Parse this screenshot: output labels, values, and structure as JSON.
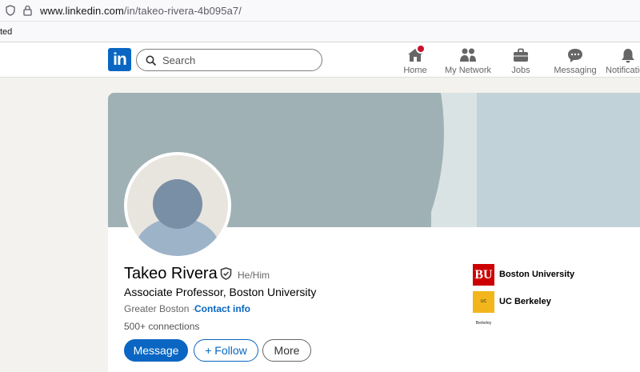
{
  "browser": {
    "url_host": "www.linkedin.com",
    "url_path": "/in/takeo-rivera-4b095a7/",
    "bookmark_partial": "ted"
  },
  "nav": {
    "logo": "in",
    "search_placeholder": "Search",
    "items": [
      {
        "label": "Home",
        "icon": "home-icon",
        "badge": true
      },
      {
        "label": "My Network",
        "icon": "network-icon"
      },
      {
        "label": "Jobs",
        "icon": "briefcase-icon"
      },
      {
        "label": "Messaging",
        "icon": "messaging-icon"
      },
      {
        "label": "Notifications",
        "icon": "bell-icon"
      }
    ],
    "brand_color": "#0a66c2",
    "badge_color": "#cb112d"
  },
  "profile": {
    "name": "Takeo Rivera",
    "pronouns": "He/Him",
    "headline": "Associate Professor, Boston University",
    "location": "Greater Boston · ",
    "contact_info": "Contact info",
    "connections": "500+ connections",
    "buttons": {
      "message": "Message",
      "follow": "+ Follow",
      "more": "More"
    },
    "organizations": [
      {
        "name": "Boston University",
        "logo_text": "BU"
      },
      {
        "name": "UC Berkeley",
        "logo_text": "UC Berkeley"
      }
    ]
  }
}
